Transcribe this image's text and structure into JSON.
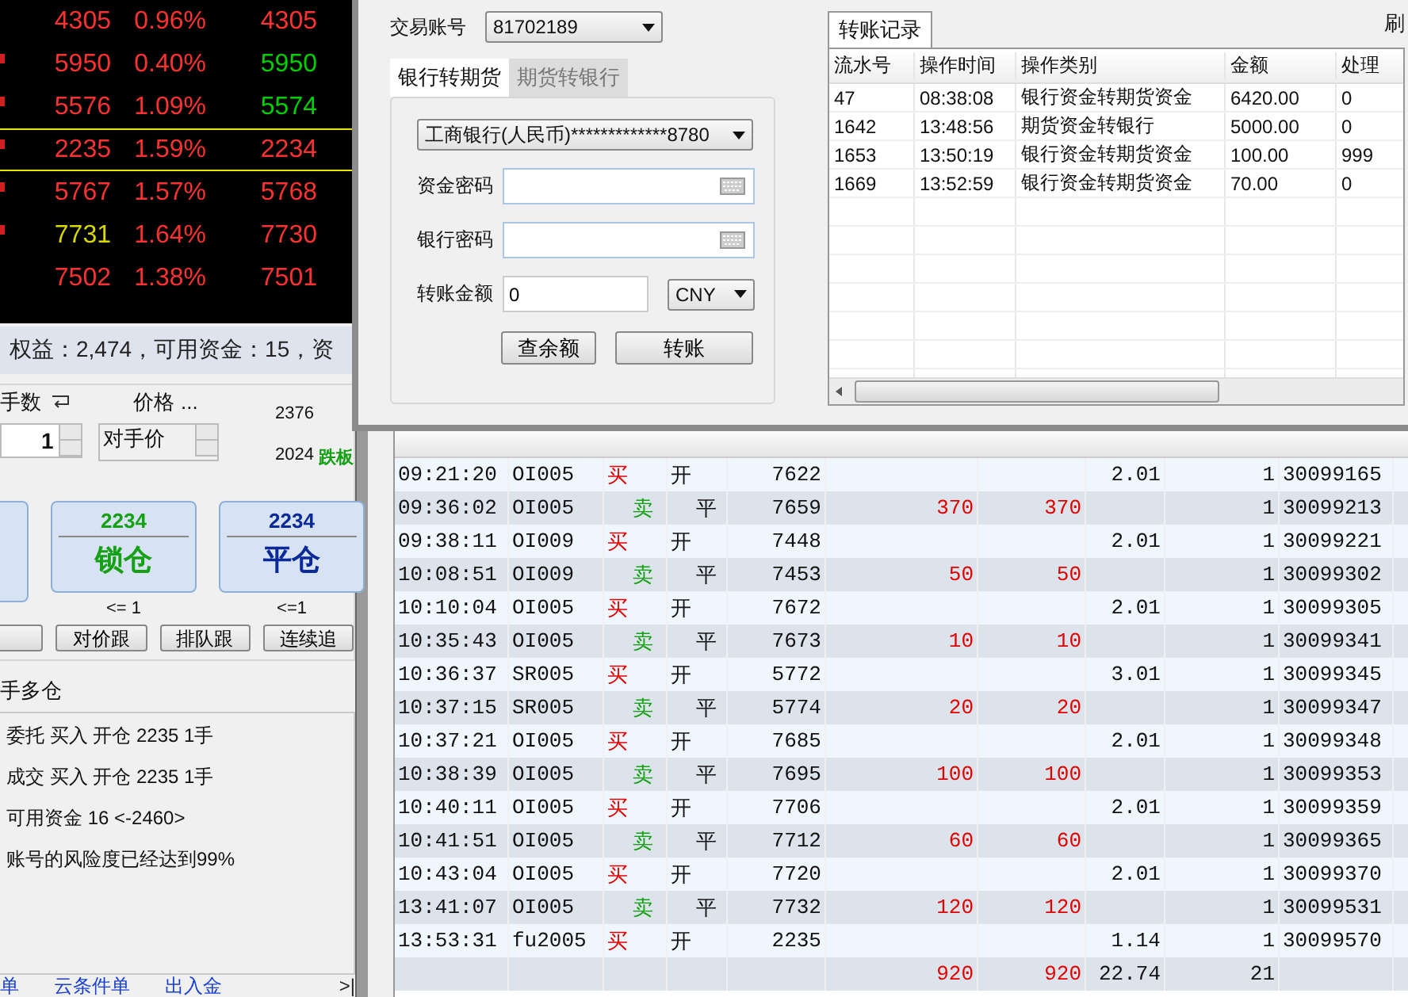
{
  "quotes": [
    {
      "price": {
        "text": "4305",
        "color": "#ff3232"
      },
      "change": "0.96%",
      "last": {
        "text": "4305",
        "color": "#ff3232"
      },
      "marked": false,
      "selected": false
    },
    {
      "price": {
        "text": "5950",
        "color": "#ff3232"
      },
      "change": "0.40%",
      "last": {
        "text": "5950",
        "color": "#00d000"
      },
      "marked": true,
      "selected": false
    },
    {
      "price": {
        "text": "5576",
        "color": "#ff3232"
      },
      "change": "1.09%",
      "last": {
        "text": "5574",
        "color": "#00d000"
      },
      "marked": true,
      "selected": false
    },
    {
      "price": {
        "text": "2235",
        "color": "#ff3232"
      },
      "change": "1.59%",
      "last": {
        "text": "2234",
        "color": "#ff3232"
      },
      "marked": true,
      "selected": true
    },
    {
      "price": {
        "text": "5767",
        "color": "#ff3232"
      },
      "change": "1.57%",
      "last": {
        "text": "5768",
        "color": "#ff3232"
      },
      "marked": true,
      "selected": false
    },
    {
      "price": {
        "text": "7731",
        "color": "#d8d800"
      },
      "change": "1.64%",
      "last": {
        "text": "7730",
        "color": "#ff3232"
      },
      "marked": true,
      "selected": false
    },
    {
      "price": {
        "text": "7502",
        "color": "#ff3232"
      },
      "change": "1.38%",
      "last": {
        "text": "7501",
        "color": "#ff3232"
      },
      "marked": false,
      "selected": false
    }
  ],
  "account_summary": "权益：2,474，可用资金：15，资",
  "order_form": {
    "lots_label": "手数",
    "lots": "1",
    "price_label": "价格",
    "price_more": "...",
    "price_type": "对手价",
    "limit_up": "2376",
    "limit_down": "2024",
    "limit_down_label": "跌板",
    "big_buttons": [
      {
        "kind": "lock",
        "price": "2234",
        "label": "锁仓",
        "limit": "<= 1"
      },
      {
        "kind": "close",
        "price": "2234",
        "label": "平仓",
        "limit": "<=1"
      }
    ],
    "follow_buttons": [
      "对价跟",
      "排队跟",
      "连续追"
    ]
  },
  "position_title": "手多仓",
  "log": [
    "委托 买入 开仓 2235 1手",
    "成交 买入 开仓 2235 1手",
    "可用资金 16 <-2460>",
    "账号的风险度已经达到99%"
  ],
  "bottom_tabs": [
    "单",
    "云条件单",
    "出入金"
  ],
  "bottom_nav": ">|",
  "dialog": {
    "account_label": "交易账号",
    "account": "81702189",
    "tabs": [
      {
        "label": "银行转期货",
        "selected": true
      },
      {
        "label": "期货转银行",
        "selected": false
      }
    ],
    "bank": "工商银行(人民币)*************8780",
    "fund_password_label": "资金密码",
    "bank_password_label": "银行密码",
    "amount_label": "转账金额",
    "amount": "0",
    "currency": "CNY",
    "buttons": [
      "查余额",
      "转账"
    ],
    "records_tab": "转账记录",
    "refresh": "刷",
    "record_columns": [
      "流水号",
      "操作时间",
      "操作类别",
      "金额",
      "处理"
    ],
    "records": [
      [
        "47",
        "08:38:08",
        "银行资金转期货资金",
        "6420.00",
        "0"
      ],
      [
        "1642",
        "13:48:56",
        "期货资金转银行",
        "5000.00",
        "0"
      ],
      [
        "1653",
        "13:50:19",
        "银行资金转期货资金",
        "100.00",
        "999"
      ],
      [
        "1669",
        "13:52:59",
        "银行资金转期货资金",
        "70.00",
        "0"
      ]
    ]
  },
  "trades": [
    {
      "time": "09:21:20",
      "contract": "OI005",
      "kind": "buy",
      "side_text": "买",
      "oc": "开",
      "price": "7622",
      "fee": "2.01",
      "qty": "1",
      "order_id": "30099165"
    },
    {
      "time": "09:36:02",
      "contract": "OI005",
      "kind": "sell",
      "side_text": "卖",
      "oc": "平",
      "price": "7659",
      "profit_1": "370",
      "profit_2": "370",
      "qty": "1",
      "order_id": "30099213"
    },
    {
      "time": "09:38:11",
      "contract": "OI009",
      "kind": "buy",
      "side_text": "买",
      "oc": "开",
      "price": "7448",
      "fee": "2.01",
      "qty": "1",
      "order_id": "30099221"
    },
    {
      "time": "10:08:51",
      "contract": "OI009",
      "kind": "sell",
      "side_text": "卖",
      "oc": "平",
      "price": "7453",
      "profit_1": "50",
      "profit_2": "50",
      "qty": "1",
      "order_id": "30099302"
    },
    {
      "time": "10:10:04",
      "contract": "OI005",
      "kind": "buy",
      "side_text": "买",
      "oc": "开",
      "price": "7672",
      "fee": "2.01",
      "qty": "1",
      "order_id": "30099305"
    },
    {
      "time": "10:35:43",
      "contract": "OI005",
      "kind": "sell",
      "side_text": "卖",
      "oc": "平",
      "price": "7673",
      "profit_1": "10",
      "profit_2": "10",
      "qty": "1",
      "order_id": "30099341"
    },
    {
      "time": "10:36:37",
      "contract": "SR005",
      "kind": "buy",
      "side_text": "买",
      "oc": "开",
      "price": "5772",
      "fee": "3.01",
      "qty": "1",
      "order_id": "30099345"
    },
    {
      "time": "10:37:15",
      "contract": "SR005",
      "kind": "sell",
      "side_text": "卖",
      "oc": "平",
      "price": "5774",
      "profit_1": "20",
      "profit_2": "20",
      "qty": "1",
      "order_id": "30099347"
    },
    {
      "time": "10:37:21",
      "contract": "OI005",
      "kind": "buy",
      "side_text": "买",
      "oc": "开",
      "price": "7685",
      "fee": "2.01",
      "qty": "1",
      "order_id": "30099348"
    },
    {
      "time": "10:38:39",
      "contract": "OI005",
      "kind": "sell",
      "side_text": "卖",
      "oc": "平",
      "price": "7695",
      "profit_1": "100",
      "profit_2": "100",
      "qty": "1",
      "order_id": "30099353"
    },
    {
      "time": "10:40:11",
      "contract": "OI005",
      "kind": "buy",
      "side_text": "买",
      "oc": "开",
      "price": "7706",
      "fee": "2.01",
      "qty": "1",
      "order_id": "30099359"
    },
    {
      "time": "10:41:51",
      "contract": "OI005",
      "kind": "sell",
      "side_text": "卖",
      "oc": "平",
      "price": "7712",
      "profit_1": "60",
      "profit_2": "60",
      "qty": "1",
      "order_id": "30099365"
    },
    {
      "time": "10:43:04",
      "contract": "OI005",
      "kind": "buy",
      "side_text": "买",
      "oc": "开",
      "price": "7720",
      "fee": "2.01",
      "qty": "1",
      "order_id": "30099370"
    },
    {
      "time": "13:41:07",
      "contract": "OI005",
      "kind": "sell",
      "side_text": "卖",
      "oc": "平",
      "price": "7732",
      "profit_1": "120",
      "profit_2": "120",
      "qty": "1",
      "order_id": "30099531"
    },
    {
      "time": "13:53:31",
      "contract": "fu2005",
      "kind": "buy",
      "side_text": "买",
      "oc": "开",
      "price": "2235",
      "fee": "1.14",
      "qty": "1",
      "order_id": "30099570"
    }
  ],
  "totals": {
    "profit_1": "920",
    "profit_2": "920",
    "fee": "22.74",
    "qty": "21"
  }
}
